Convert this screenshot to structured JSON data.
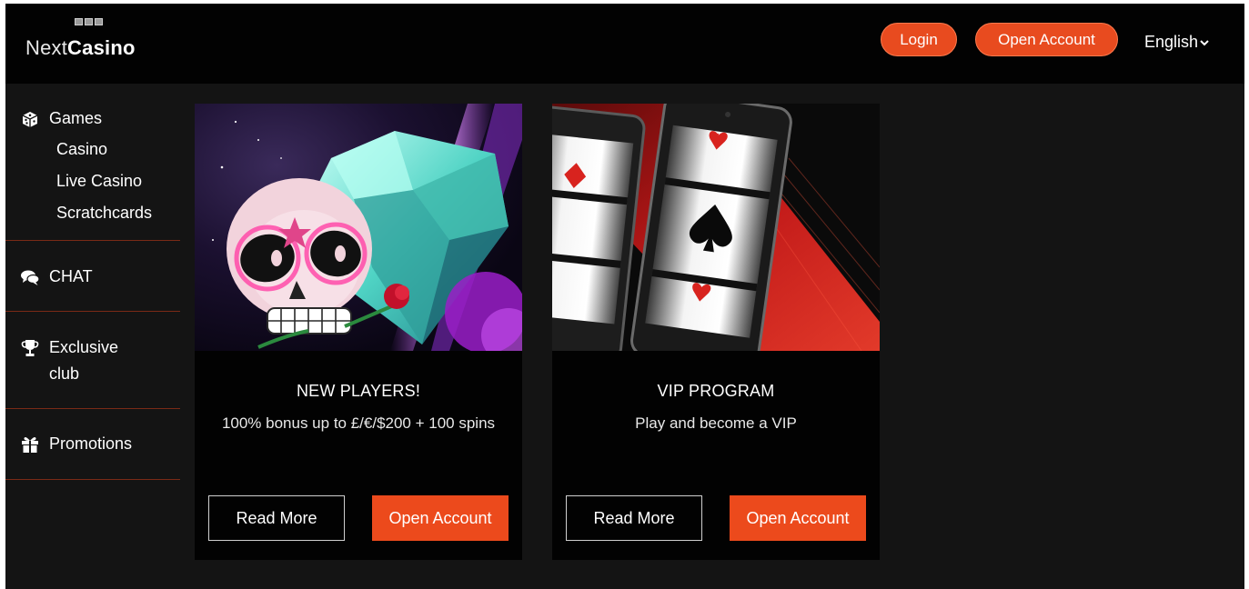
{
  "brand": {
    "name_light": "Next",
    "name_bold": "Casino"
  },
  "header": {
    "login_label": "Login",
    "open_account_label": "Open Account",
    "language": "English"
  },
  "sidebar": {
    "games": {
      "label": "Games",
      "items": [
        "Casino",
        "Live Casino",
        "Scratchcards"
      ]
    },
    "chat": {
      "label": "CHAT"
    },
    "club": {
      "label_line1": "Exclusive",
      "label_line2": "club"
    },
    "promotions": {
      "label": "Promotions"
    }
  },
  "cards": [
    {
      "title": "NEW PLAYERS!",
      "subtitle": "100% bonus up to £/€/$200 + 100 spins",
      "read_more": "Read More",
      "open_account": "Open Account"
    },
    {
      "title": "VIP PROGRAM",
      "subtitle": "Play and become a VIP",
      "read_more": "Read More",
      "open_account": "Open Account"
    }
  ],
  "colors": {
    "accent": "#e84b1f",
    "background": "#141414",
    "header_bg": "#020202",
    "divider": "#7a2a16"
  },
  "icons": {
    "games": "dice-icon",
    "chat": "chat-bubbles-icon",
    "club": "trophy-icon",
    "promotions": "gift-icon",
    "language": "chevron-down-icon"
  }
}
